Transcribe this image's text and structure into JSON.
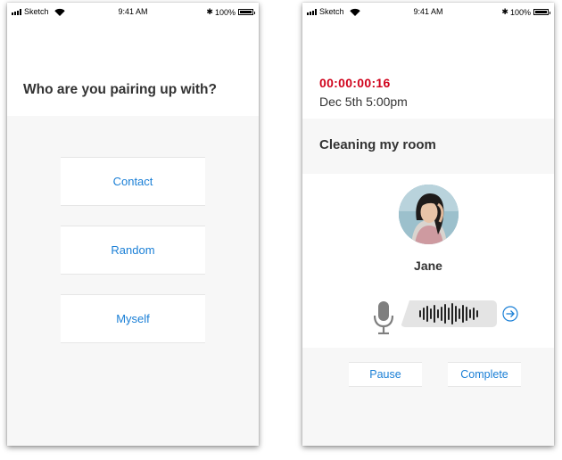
{
  "status_bar": {
    "carrier": "Sketch",
    "time": "9:41 AM",
    "battery": "100%"
  },
  "pairing": {
    "title": "Who are you pairing up with?",
    "options": [
      "Contact",
      "Random",
      "Myself"
    ]
  },
  "session": {
    "timer": "00:00:00:16",
    "datetime": "Dec 5th 5:00pm",
    "task": "Cleaning my room",
    "partner_name": "Jane",
    "pause_label": "Pause",
    "complete_label": "Complete"
  },
  "colors": {
    "accent": "#1a7fd6",
    "timer": "#d0021b"
  },
  "icons": [
    "signal-icon",
    "wifi-icon",
    "bluetooth-icon",
    "battery-icon",
    "microphone-icon",
    "audio-waveform-icon",
    "send-arrow-icon"
  ]
}
